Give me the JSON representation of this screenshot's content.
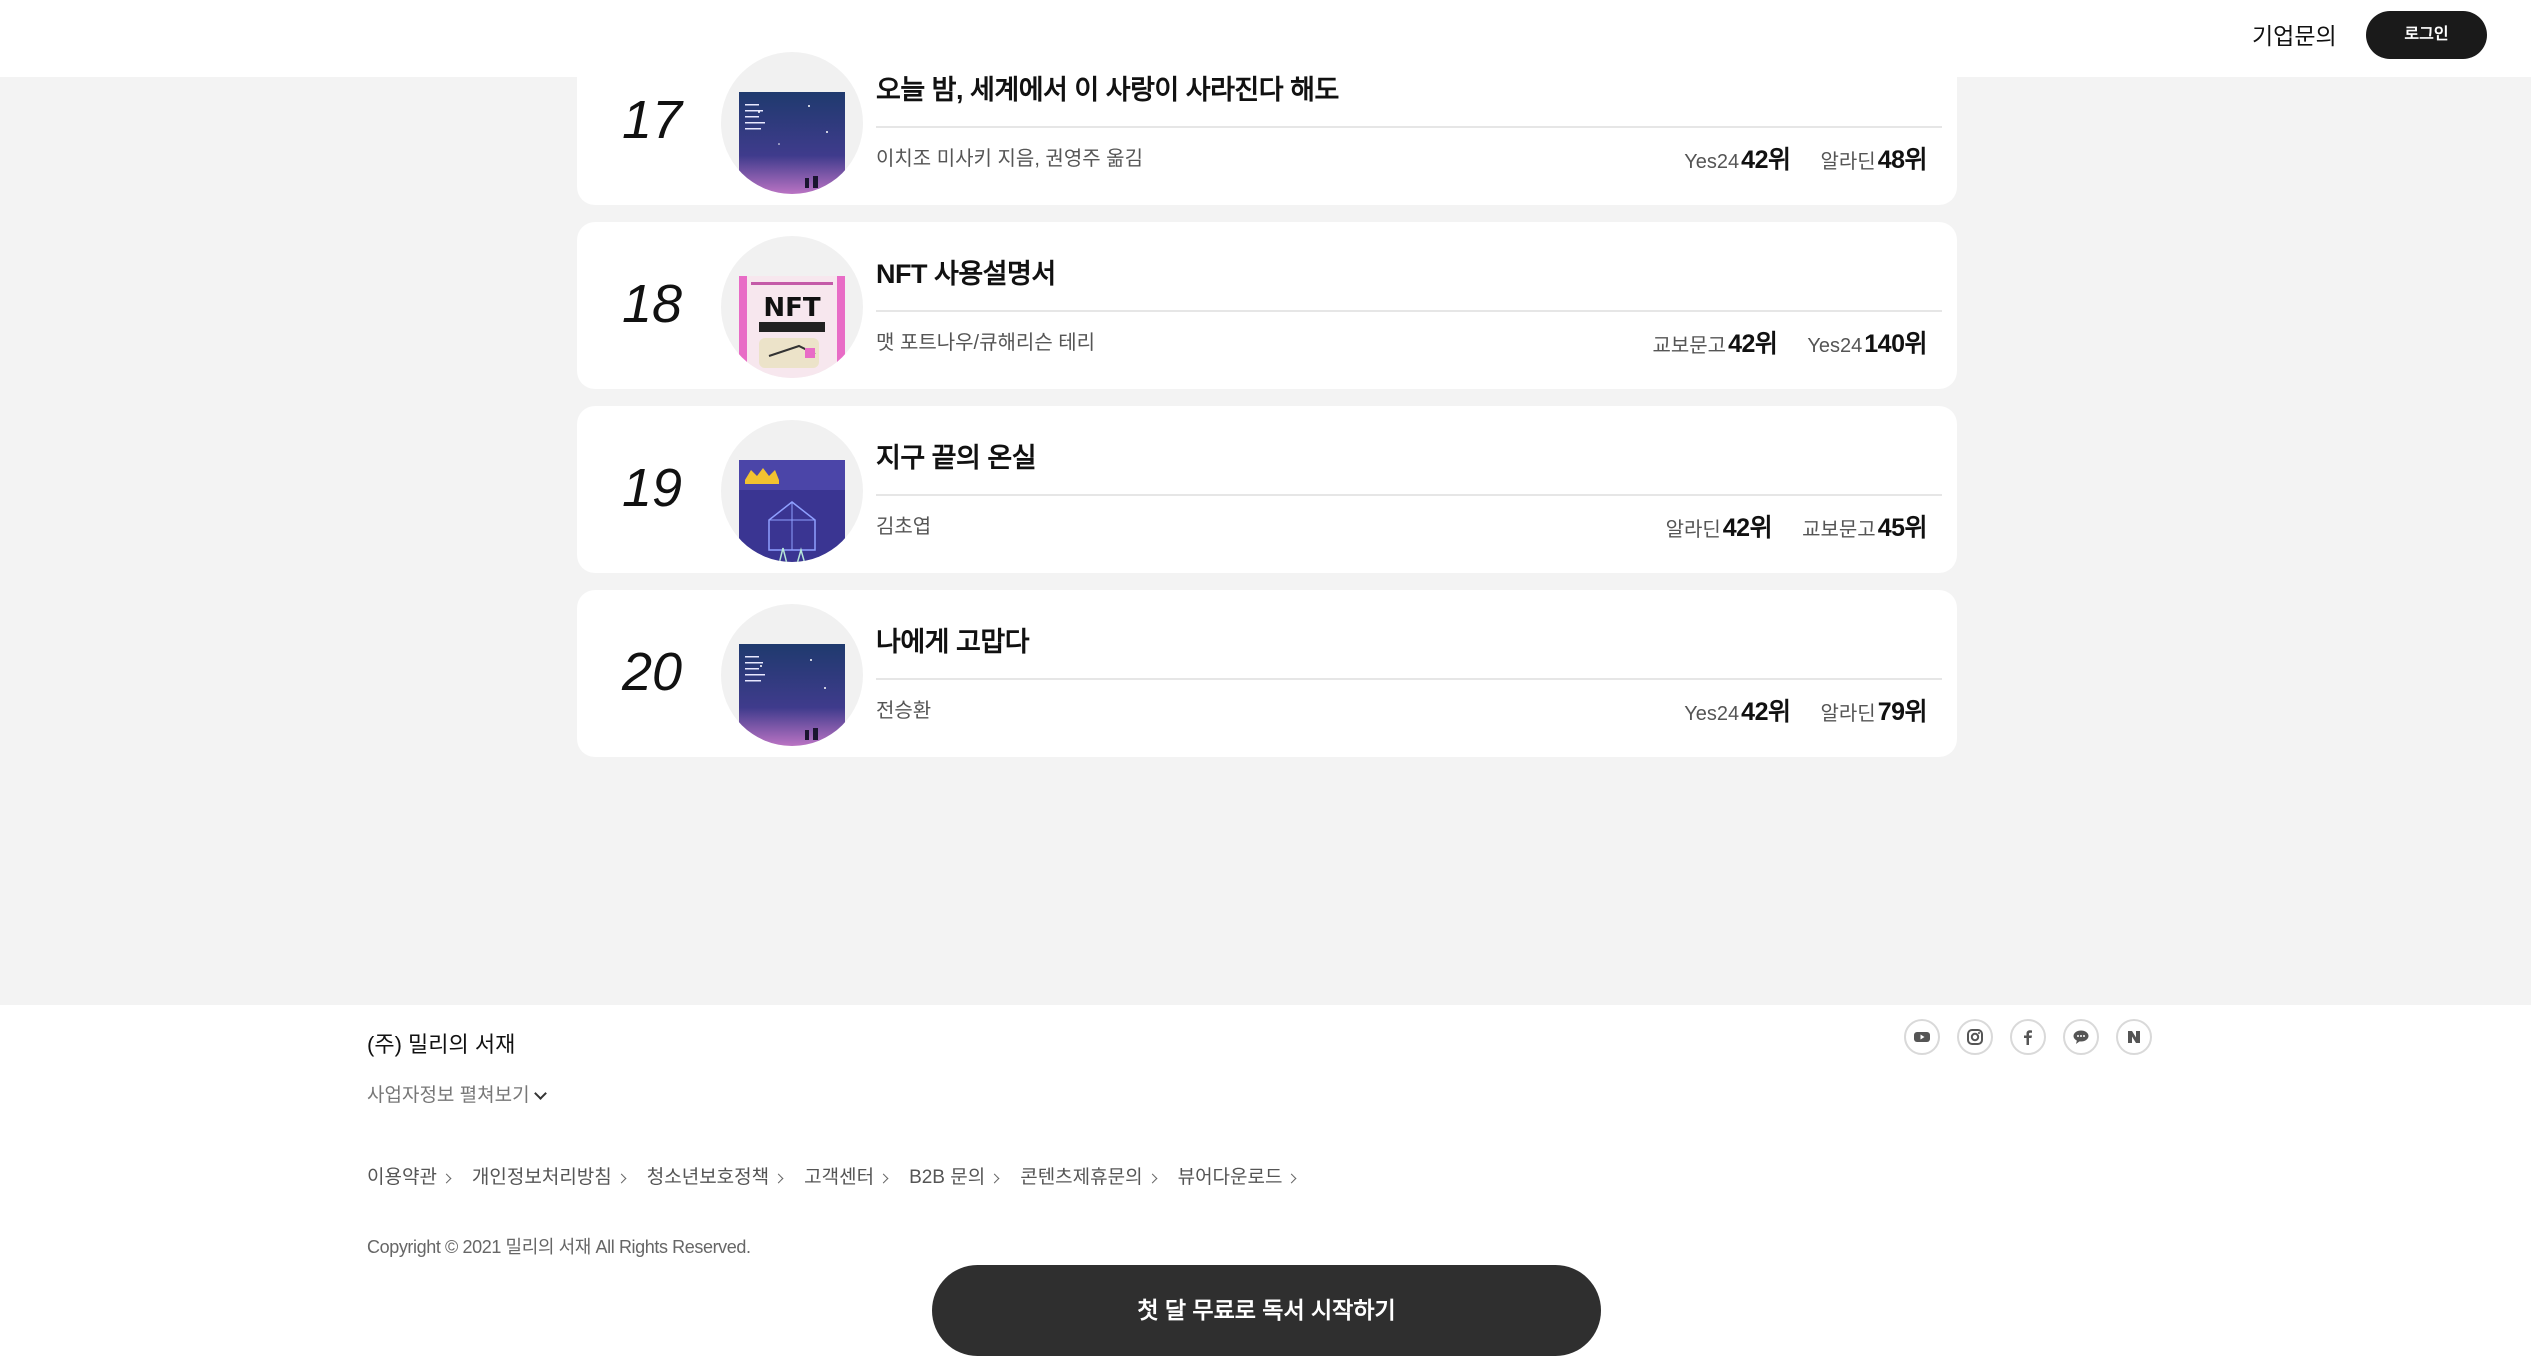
{
  "header": {
    "corp_inquiry": "기업문의",
    "login": "로그인"
  },
  "books": [
    {
      "rank": "17",
      "title": "오늘 밤, 세계에서 이 사랑이 사라진다 해도",
      "author": "이치조 미사키 지음, 권영주 옮김",
      "cover": "night-sky-cover",
      "ranks": [
        {
          "store": "Yes24",
          "pos": "42위"
        },
        {
          "store": "알라딘",
          "pos": "48위"
        }
      ]
    },
    {
      "rank": "18",
      "title": "NFT 사용설명서",
      "author": "맷 포트나우/큐해리슨 테리",
      "cover": "nft-cover",
      "ranks": [
        {
          "store": "교보문고",
          "pos": "42위"
        },
        {
          "store": "Yes24",
          "pos": "140위"
        }
      ]
    },
    {
      "rank": "19",
      "title": "지구 끝의 온실",
      "author": "김초엽",
      "cover": "greenhouse-cover",
      "ranks": [
        {
          "store": "알라딘",
          "pos": "42위"
        },
        {
          "store": "교보문고",
          "pos": "45위"
        }
      ]
    },
    {
      "rank": "20",
      "title": "나에게 고맙다",
      "author": "전승환",
      "cover": "night-sky-cover",
      "ranks": [
        {
          "store": "Yes24",
          "pos": "42위"
        },
        {
          "store": "알라딘",
          "pos": "79위"
        }
      ]
    }
  ],
  "footer": {
    "company": "(주) 밀리의 서재",
    "business_info": "사업자정보 펼쳐보기",
    "links": [
      "이용약관",
      "개인정보처리방침",
      "청소년보호정책",
      "고객센터",
      "B2B 문의",
      "콘텐츠제휴문의",
      "뷰어다운로드"
    ],
    "copyright": "Copyright © 2021 밀리의 서재 All Rights Reserved.",
    "social": [
      "youtube-icon",
      "instagram-icon",
      "facebook-icon",
      "talk-icon",
      "naver-icon"
    ]
  },
  "cta": "첫 달 무료로 독서 시작하기"
}
